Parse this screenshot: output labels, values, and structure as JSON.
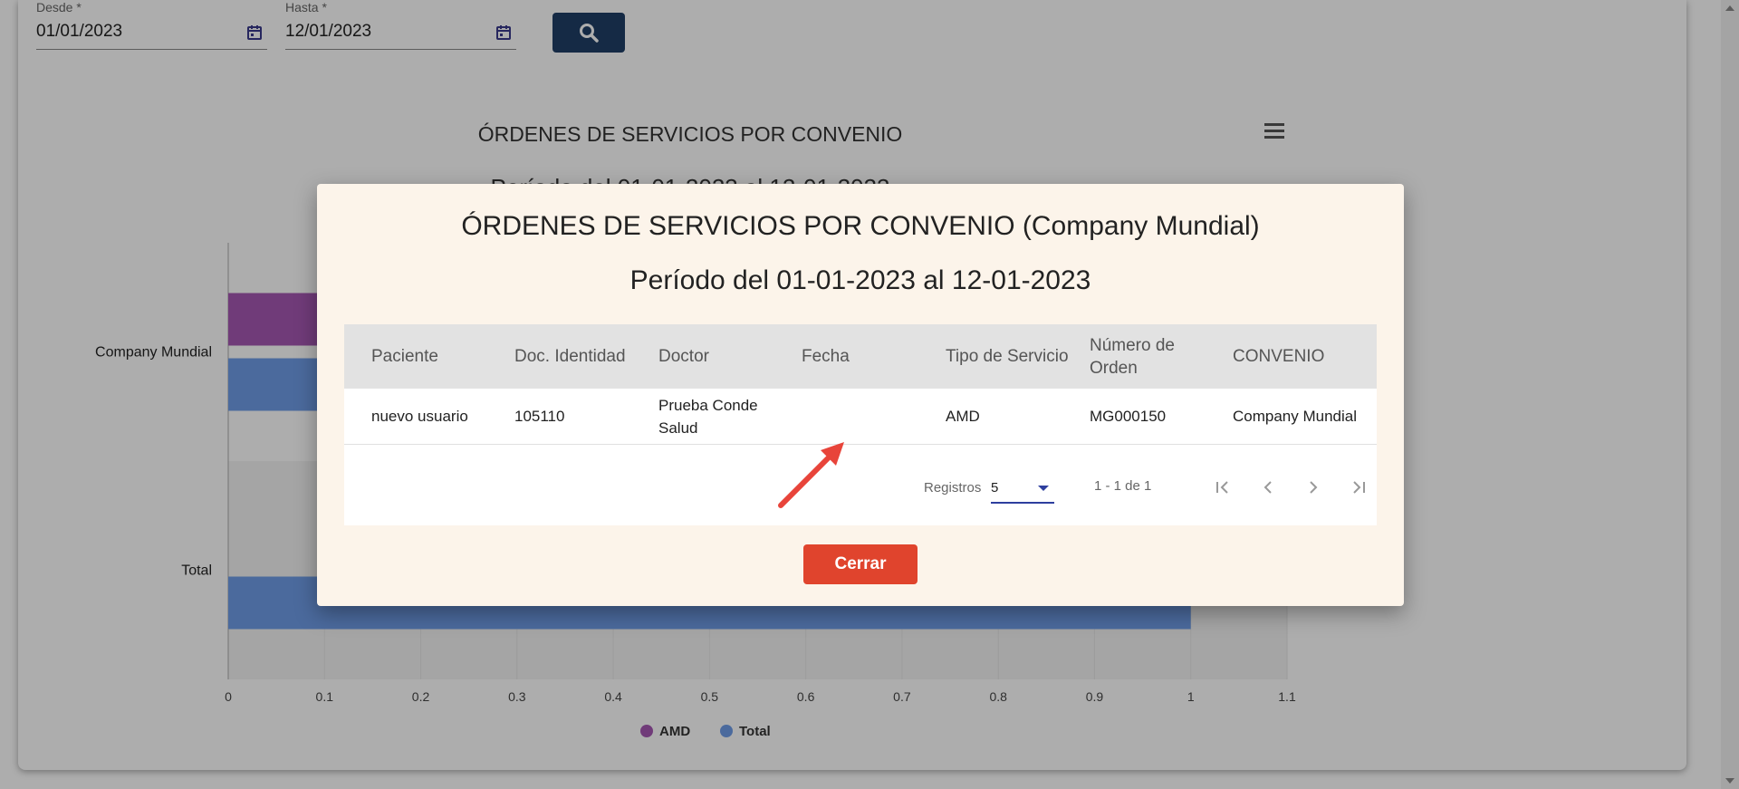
{
  "filters": {
    "from": {
      "label": "Desde *",
      "value": "01/01/2023",
      "icon": "calendar-icon"
    },
    "to": {
      "label": "Hasta *",
      "value": "12/01/2023",
      "icon": "calendar-icon"
    },
    "search_icon": "search-icon"
  },
  "chart_menu_icon": "hamburger-menu-icon",
  "chart_data": {
    "type": "bar",
    "orientation": "horizontal",
    "title": "ÓRDENES DE SERVICIOS POR CONVENIO",
    "subtitle": "Período del 01-01-2023 al 12-01-2023",
    "categories": [
      "Company Mundial",
      "Total"
    ],
    "series": [
      {
        "name": "AMD",
        "values": [
          1,
          null
        ],
        "color": "#a657b3"
      },
      {
        "name": "Total",
        "values": [
          1,
          1
        ],
        "color": "#6f9de8"
      }
    ],
    "x_ticks": [
      "0",
      "0.1",
      "0.2",
      "0.3",
      "0.4",
      "0.5",
      "0.6",
      "0.7",
      "0.8",
      "0.9",
      "1",
      "1.1"
    ],
    "xlim": [
      0,
      1.1
    ],
    "grid": true,
    "legend": "bottom-center"
  },
  "modal": {
    "title": "ÓRDENES DE SERVICIOS POR CONVENIO (Company Mundial)",
    "subtitle": "Período del 01-01-2023 al 12-01-2023",
    "table": {
      "headers": {
        "paciente": "Paciente",
        "doc": "Doc. Identidad",
        "doctor": "Doctor",
        "fecha": "Fecha",
        "tipo": "Tipo de Servicio",
        "numero": "Número de Orden",
        "convenio": "CONVENIO"
      },
      "rows": [
        {
          "paciente": "nuevo usuario",
          "doc": "105110",
          "doctor": "Prueba Conde Salud",
          "fecha": "",
          "tipo": "AMD",
          "numero": "MG000150",
          "convenio": "Company Mundial"
        }
      ]
    },
    "pager": {
      "label": "Registros",
      "page_size": "5",
      "range": "1 - 1 de 1",
      "icons": [
        "first-page-icon",
        "previous-page-icon",
        "next-page-icon",
        "last-page-icon"
      ]
    },
    "close_label": "Cerrar"
  },
  "colors": {
    "search_button": "#1f3f66",
    "close_button": "#e0442d",
    "modal_background": "#fcf4ea",
    "annotation_arrow": "#e8443a"
  }
}
